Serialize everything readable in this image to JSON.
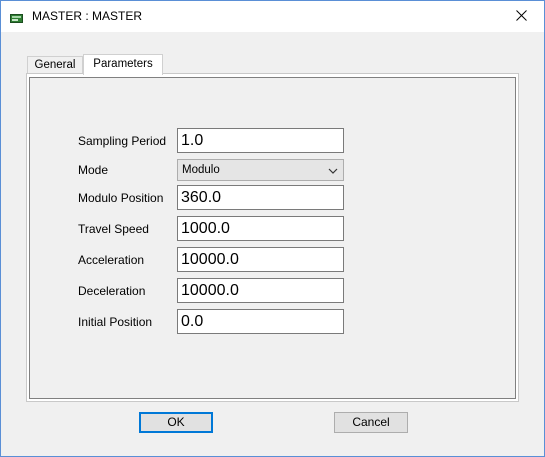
{
  "window": {
    "title": "MASTER : MASTER"
  },
  "tabs": [
    {
      "label": "General",
      "selected": false
    },
    {
      "label": "Parameters",
      "selected": true
    }
  ],
  "form": {
    "sampling_period": {
      "label": "Sampling Period",
      "value": "1.0"
    },
    "mode": {
      "label": "Mode",
      "value": "Modulo"
    },
    "modulo_position": {
      "label": "Modulo Position",
      "value": "360.0"
    },
    "travel_speed": {
      "label": "Travel Speed",
      "value": "1000.0"
    },
    "acceleration": {
      "label": "Acceleration",
      "value": "10000.0"
    },
    "deceleration": {
      "label": "Deceleration",
      "value": "10000.0"
    },
    "initial_position": {
      "label": "Initial Position",
      "value": "0.0"
    }
  },
  "buttons": {
    "ok": "OK",
    "cancel": "Cancel"
  },
  "colors": {
    "window_border": "#5a8fd6",
    "default_button_border": "#0078d7",
    "dialog_background": "#f0f0f0"
  },
  "icons": {
    "app": "app-window-icon",
    "close": "close-icon",
    "dropdown": "chevron-down-icon"
  }
}
